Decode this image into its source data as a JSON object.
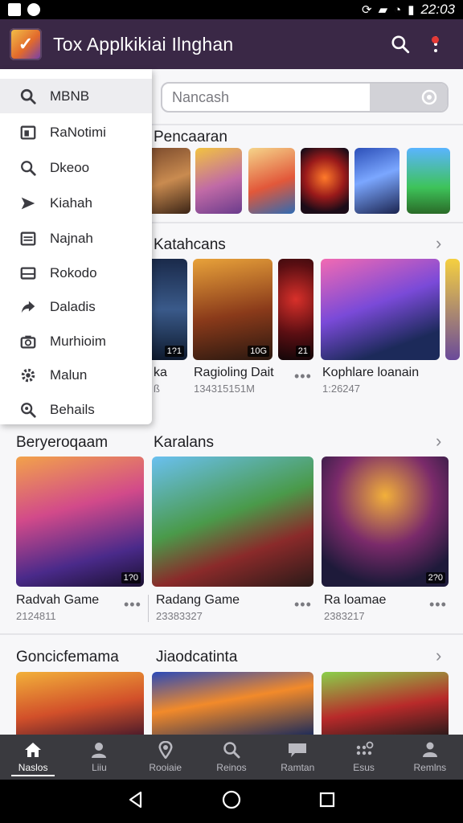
{
  "status_bar": {
    "time": "22:03"
  },
  "app_bar": {
    "title": "Tox Applkikiai Ilnghan",
    "logo_text": "✓"
  },
  "search": {
    "placeholder": "Nancash"
  },
  "drawer": {
    "items": [
      {
        "label": "MBNB",
        "icon": "search-icon"
      },
      {
        "label": "RaNotimi",
        "icon": "square-icon"
      },
      {
        "label": "Dkeoo",
        "icon": "search-icon"
      },
      {
        "label": "Kiahah",
        "icon": "send-icon"
      },
      {
        "label": "Najnah",
        "icon": "list-icon"
      },
      {
        "label": "Rokodo",
        "icon": "inbox-icon"
      },
      {
        "label": "Daladis",
        "icon": "share-icon"
      },
      {
        "label": "Murhioim",
        "icon": "camera-icon"
      },
      {
        "label": "Malun",
        "icon": "gear-icon"
      },
      {
        "label": "Behails",
        "icon": "zoom-icon"
      }
    ]
  },
  "sections": {
    "pencaaran": {
      "title": "Pencaaran"
    },
    "katahcans": {
      "title": "Katahcans",
      "cards": [
        {
          "title": "ka",
          "subtitle": "ß",
          "badge": "1?1"
        },
        {
          "title": "Ragioling Dait",
          "subtitle": "134315151M",
          "badge": "10G",
          "img_badge2": "21"
        },
        {
          "title": "Kophlare loanain",
          "subtitle": "1:26247",
          "badge": ""
        }
      ]
    },
    "beryeroqaam": {
      "title": "Beryeroqaam",
      "cards": [
        {
          "title": "Radvah Game",
          "subtitle": "2124811",
          "badge": "1?0"
        }
      ]
    },
    "karalans": {
      "title": "Karalans",
      "cards": [
        {
          "title": "Radang Game",
          "subtitle": "23383327",
          "badge": ""
        },
        {
          "title": "Ra loamae",
          "subtitle": "2383217",
          "badge": "2?0"
        }
      ]
    },
    "goncicfemama": {
      "title": "Goncicfemama"
    },
    "jiaodcatinta": {
      "title": "Jiaodcatinta"
    }
  },
  "bottom_nav": {
    "items": [
      {
        "label": "Naslos",
        "icon": "home-icon",
        "active": true
      },
      {
        "label": "Liiu",
        "icon": "person-icon"
      },
      {
        "label": "Rooiaie",
        "icon": "location-icon"
      },
      {
        "label": "Reinos",
        "icon": "search-icon"
      },
      {
        "label": "Ramtan",
        "icon": "chat-icon"
      },
      {
        "label": "Esus",
        "icon": "apps-icon"
      },
      {
        "label": "Remlns",
        "icon": "people-icon"
      }
    ]
  },
  "colors": {
    "app_bar": "#3a2846",
    "bottom_nav": "#3a3a3f",
    "background": "#f7f7f9"
  }
}
